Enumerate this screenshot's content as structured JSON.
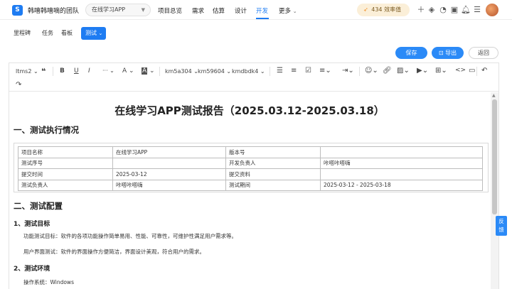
{
  "app": {
    "logo_letter": "S",
    "team_name": "韩嘻韩嘻嘀的团队",
    "project": "在线学习APP"
  },
  "nav": {
    "items": [
      "项目总览",
      "需求",
      "估算",
      "设计",
      "开发",
      "更多"
    ],
    "active": "开发"
  },
  "efficiency": {
    "value": "434",
    "label": "效率值",
    "accent": "#f08a1e"
  },
  "top_icons": [
    "plus-icon",
    "layers-icon",
    "pie-chart-icon",
    "cube-icon",
    "calendar-icon",
    "bell-icon",
    "settings-sliders-icon"
  ],
  "subtabs": {
    "items": [
      "里程碑",
      "任务",
      "看板"
    ],
    "active": "测试"
  },
  "actions": {
    "save": "保存",
    "export": "导出",
    "back": "返回"
  },
  "toolbar": {
    "heading": "ltms2",
    "font_a": "km5a304",
    "font_b": "km59604",
    "font_c": "kmdbdk4",
    "ellipsis": "···"
  },
  "doc": {
    "title": "在线学习APP测试报告（2025.03.12-2025.03.18）",
    "section1": "一、测试执行情况",
    "table": [
      [
        "项目名称",
        "在线学习APP",
        "版本号",
        ""
      ],
      [
        "测试序号",
        "",
        "开发负责人",
        "咔嗒咔嗒嗨"
      ],
      [
        "提交时间",
        "2025-03-12",
        "提交资料",
        ""
      ],
      [
        "测试负责人",
        "咔嗒咔嗒嗨",
        "测试期间",
        "2025-03-12 - 2025-03-18"
      ]
    ],
    "section2": "二、测试配置",
    "sub1": "1、测试目标",
    "para1": "功能测试目标：软件的各项功能操作简单易用、性能、可靠性，可维护性满足用户需求等。",
    "para2": "用户界面测试：软件的界面操作方便简洁，界面设计美观，符合用户的需求。",
    "sub2": "2、测试环境",
    "para3": "操作系统：Windows"
  },
  "feedback": {
    "line1": "反",
    "line2": "馈"
  },
  "colors": {
    "primary": "#1e7cf2",
    "button": "#2b8af7"
  }
}
